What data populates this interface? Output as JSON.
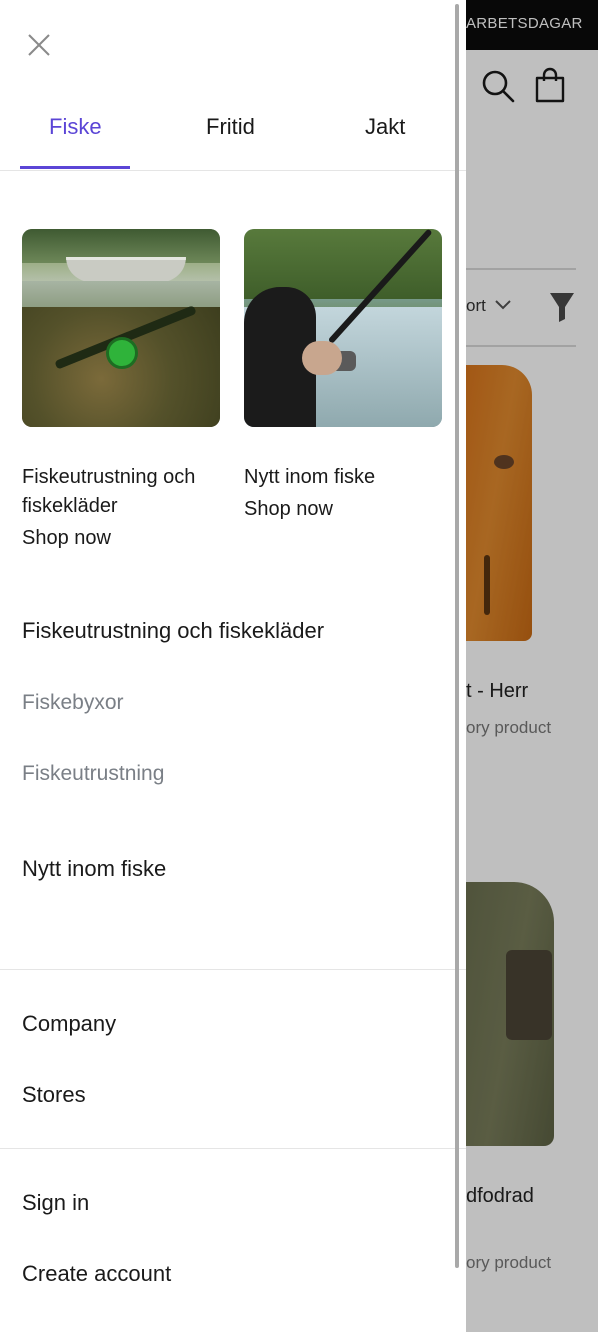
{
  "background_page": {
    "topbar_text": "ARBETSDAGAR",
    "sort_label": "ort",
    "product1": {
      "title": "t - Herr",
      "subtitle": "ory product"
    },
    "product2": {
      "title": "dfodrad",
      "subtitle": "ory product"
    },
    "icons": [
      "search-icon",
      "shopping-bag-icon",
      "chevron-down-icon",
      "filter-icon"
    ]
  },
  "drawer": {
    "close_icon": "close-icon",
    "tabs": [
      {
        "label": "Fiske",
        "active": true
      },
      {
        "label": "Fritid",
        "active": false
      },
      {
        "label": "Jakt",
        "active": false
      }
    ],
    "accent_color": "#5b45d6",
    "featured": [
      {
        "title": "Fiskeutrustning och fiskekläder",
        "cta": "Shop now"
      },
      {
        "title": "Nytt inom fiske",
        "cta": "Shop now"
      }
    ],
    "sections": [
      {
        "heading": "Fiskeutrustning och fiskekläder",
        "items": [
          "Fiskebyxor",
          "Fiskeutrustning"
        ]
      },
      {
        "heading": "Nytt inom fiske",
        "items": []
      }
    ],
    "company_links": [
      "Company",
      "Stores"
    ],
    "account_links": [
      "Sign in",
      "Create account"
    ]
  }
}
